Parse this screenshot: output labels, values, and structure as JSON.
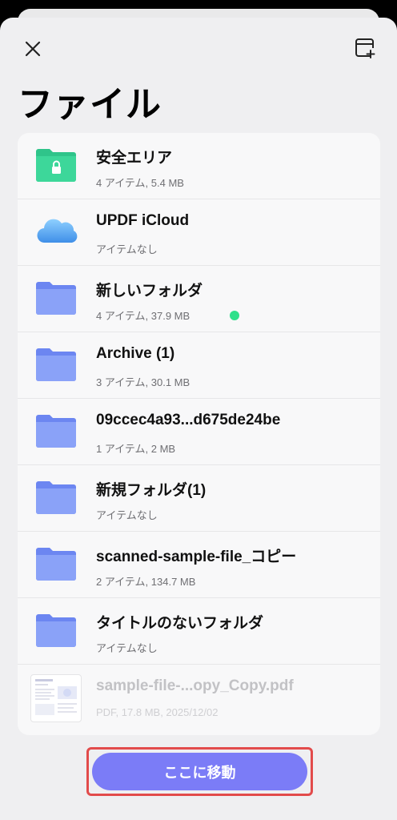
{
  "header": {
    "title": "ファイル",
    "close_icon": "close-icon",
    "new_folder_icon": "new-folder-icon"
  },
  "items": [
    {
      "name": "安全エリア",
      "meta": "4 アイテム, 5.4 MB",
      "icon": "secure-folder-icon",
      "color": "#2fc48a"
    },
    {
      "name": "UPDF iCloud",
      "meta": "アイテムなし",
      "icon": "icloud-icon",
      "color": "#4aa8f0"
    },
    {
      "name": "新しいフォルダ",
      "meta": "4 アイテム, 37.9 MB",
      "icon": "folder-icon",
      "color": "#7f97f6",
      "status_color": "#2ee08a"
    },
    {
      "name": "Archive (1)",
      "meta": "3 アイテム, 30.1 MB",
      "icon": "folder-icon",
      "color": "#7f97f6"
    },
    {
      "name": "09ccec4a93...d675de24be",
      "meta": "1 アイテム, 2 MB",
      "icon": "folder-icon",
      "color": "#7f97f6"
    },
    {
      "name": "新規フォルダ(1)",
      "meta": "アイテムなし",
      "icon": "folder-icon",
      "color": "#7f97f6"
    },
    {
      "name": "scanned-sample-file_コピー",
      "meta": "2 アイテム, 134.7 MB",
      "icon": "folder-icon",
      "color": "#7f97f6"
    },
    {
      "name": "タイトルのないフォルダ",
      "meta": "アイテムなし",
      "icon": "folder-icon",
      "color": "#7f97f6"
    },
    {
      "name": "sample-file-...opy_Copy.pdf",
      "meta": "PDF, 17.8 MB, 2025/12/02",
      "icon": "pdf-thumbnail",
      "disabled": true
    }
  ],
  "footer": {
    "move_label": "ここに移動",
    "accent": "#7b7cf7",
    "highlight": "#e24b4b"
  }
}
